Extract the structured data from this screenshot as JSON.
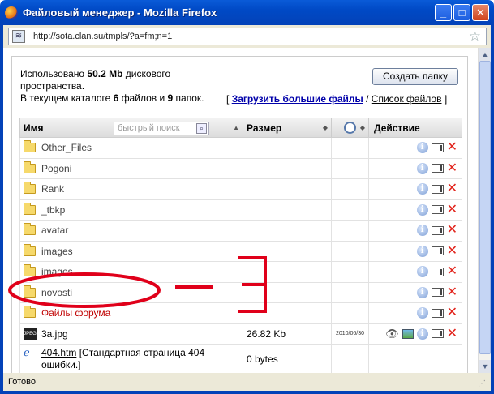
{
  "window": {
    "title": "Файловый менеджер - Mozilla Firefox",
    "minimize": "_",
    "maximize": "□",
    "close": "✕"
  },
  "address": {
    "url": "http://sota.clan.su/tmpls/?a=fm;n=1"
  },
  "info": {
    "used_label": "Использовано",
    "used_value": "50.2 Mb",
    "used_suffix": "дискового пространства.",
    "catalog_prefix": "В текущем каталоге",
    "files_count": "6",
    "files_word": "файлов и",
    "folders_count": "9",
    "folders_word": "папок."
  },
  "buttons": {
    "create_folder": "Создать папку"
  },
  "links": {
    "open_bracket": "[",
    "upload_large": "Загрузить большие файлы",
    "separator": "/",
    "file_list": "Список файлов",
    "close_bracket": "]"
  },
  "table": {
    "headers": {
      "name": "Имя",
      "size": "Размер",
      "action": "Действие"
    },
    "search_placeholder": "быстрый поиск",
    "folders": [
      {
        "name": "Other_Files"
      },
      {
        "name": "Pogoni"
      },
      {
        "name": "Rank"
      },
      {
        "name": "_tbkp"
      },
      {
        "name": "avatar"
      },
      {
        "name": "images"
      },
      {
        "name": "images"
      },
      {
        "name": "novosti"
      },
      {
        "name": "Файлы форума"
      }
    ],
    "files": [
      {
        "name": "3a.jpg",
        "size": "26.82 Kb",
        "date": "2010/06/30"
      },
      {
        "name": "404.htm",
        "desc": "[Стандартная страница 404 ошибки.]",
        "size": "0 bytes",
        "date": ""
      }
    ]
  },
  "status": {
    "text": "Готово"
  },
  "colors": {
    "titlebar": "#0049c5",
    "annotation": "#e0001a",
    "delete": "#e2241c"
  }
}
